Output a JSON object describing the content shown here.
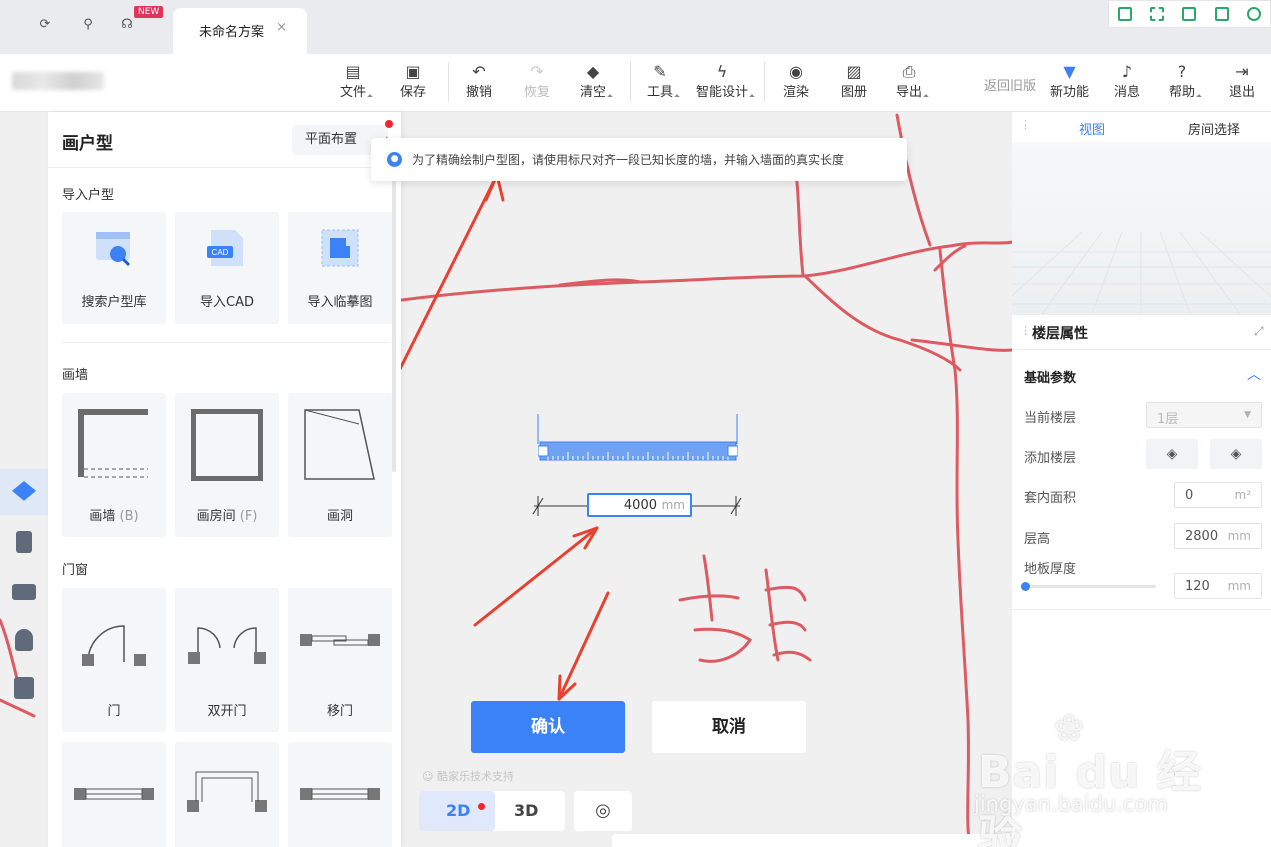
{
  "browser": {
    "new_badge": "NEW",
    "tab_title": "未命名方案",
    "tab_close": "×"
  },
  "toolbar": {
    "tools": [
      {
        "label": "文件",
        "icon": "file-icon"
      },
      {
        "label": "保存",
        "icon": "save-icon"
      },
      {
        "label": "撤销",
        "icon": "undo-icon"
      },
      {
        "label": "恢复",
        "icon": "redo-icon"
      },
      {
        "label": "清空",
        "icon": "eraser-icon"
      },
      {
        "label": "工具",
        "icon": "wrench-icon"
      },
      {
        "label": "智能设计",
        "icon": "lightning-icon"
      },
      {
        "label": "渲染",
        "icon": "camera-icon"
      },
      {
        "label": "图册",
        "icon": "album-icon"
      },
      {
        "label": "导出",
        "icon": "export-icon"
      },
      {
        "label": "新功能",
        "icon": "new-feature-icon"
      },
      {
        "label": "消息",
        "icon": "bell-icon"
      },
      {
        "label": "帮助",
        "icon": "help-icon"
      },
      {
        "label": "退出",
        "icon": "logout-icon"
      }
    ],
    "back_old": "返回旧版"
  },
  "left_panel": {
    "title": "画户型",
    "layout_button": "平面布置",
    "sections": {
      "import": "导入户型",
      "walls": "画墙",
      "doors": "门窗"
    },
    "import_cards": [
      {
        "label": "搜索户型库"
      },
      {
        "label": "导入CAD",
        "icon_text": "CAD"
      },
      {
        "label": "导入临摹图"
      }
    ],
    "wall_cards": [
      {
        "label": "画墙",
        "hint": "(B)"
      },
      {
        "label": "画房间",
        "hint": "(F)"
      },
      {
        "label": "画洞",
        "hint": ""
      }
    ],
    "door_cards": [
      {
        "label": "门"
      },
      {
        "label": "双开门"
      },
      {
        "label": "移门"
      }
    ]
  },
  "tooltip": {
    "text": "为了精确绘制户型图，请使用标尺对齐一段已知长度的墙，并输入墙面的真实长度"
  },
  "ruler_input": {
    "value": "4000",
    "unit": "mm"
  },
  "actions": {
    "confirm": "确认",
    "cancel": "取消"
  },
  "canvas_footer": {
    "support_text": "酷家乐技术支持",
    "view_2d": "2D",
    "view_3d": "3D"
  },
  "right_panel": {
    "tabs": [
      "视图",
      "房间选择"
    ],
    "active_tab": "视图",
    "section_title": "楼层属性",
    "subsection": "基础参数",
    "fields": {
      "current_floor": {
        "label": "当前楼层",
        "value": "1层"
      },
      "add_floor": {
        "label": "添加楼层"
      },
      "area": {
        "label": "套内面积",
        "value": "0",
        "unit": "m²"
      },
      "height": {
        "label": "层高",
        "value": "2800",
        "unit": "mm"
      },
      "floor_thickness": {
        "label": "地板厚度",
        "value": "120",
        "unit": "mm"
      }
    }
  },
  "watermark": {
    "big": "Bai du 经验",
    "small": "jingyan.baidu.com"
  },
  "colors": {
    "accent": "#3b82f6",
    "badge": "#e2335b",
    "sketch": "#d9414a",
    "corner_tools": "#2aa86a"
  }
}
